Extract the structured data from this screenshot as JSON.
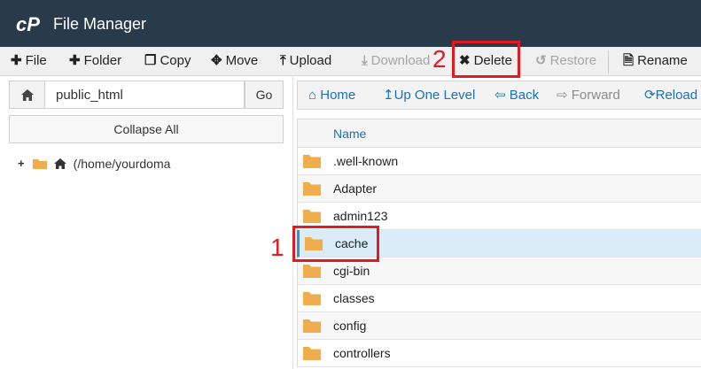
{
  "header": {
    "title": "File Manager"
  },
  "toolbar": {
    "file": "File",
    "folder": "Folder",
    "copy": "Copy",
    "move": "Move",
    "upload": "Upload",
    "download": "Download",
    "delete": "Delete",
    "restore": "Restore",
    "rename": "Rename"
  },
  "left_pane": {
    "path_value": "public_html",
    "go_label": "Go",
    "collapse_label": "Collapse All",
    "tree_root_label": "(/home/yourdoma"
  },
  "nav": {
    "home": "Home",
    "up": "Up One Level",
    "back": "Back",
    "forward": "Forward",
    "reload": "Reload"
  },
  "list": {
    "column_name": "Name",
    "rows": [
      ".well-known",
      "Adapter",
      "admin123",
      "cache",
      "cgi-bin",
      "classes",
      "config",
      "controllers"
    ],
    "selected": "cache"
  },
  "annotations": {
    "step1": "1",
    "step2": "2"
  },
  "colors": {
    "header_bg": "#293a4a",
    "link": "#1a73b8",
    "annotation": "#e01b22",
    "folder": "#f0ad4e",
    "selected_row": "#d9ecf8"
  }
}
